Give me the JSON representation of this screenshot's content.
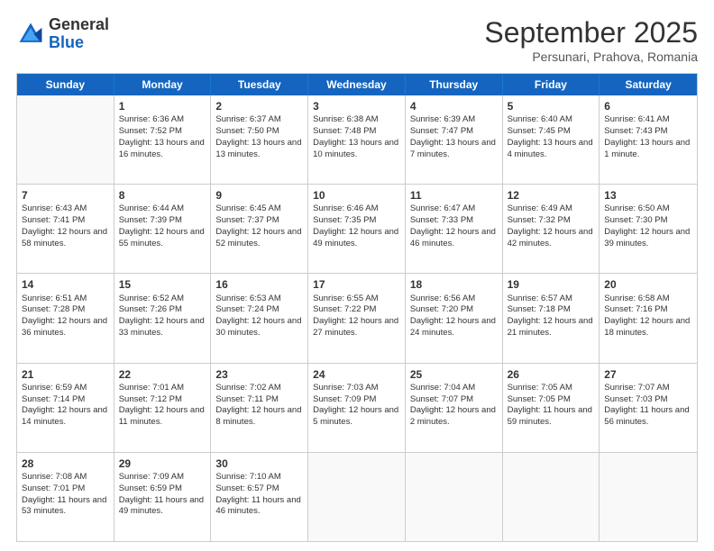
{
  "header": {
    "logo_general": "General",
    "logo_blue": "Blue",
    "month_title": "September 2025",
    "subtitle": "Persunari, Prahova, Romania"
  },
  "day_names": [
    "Sunday",
    "Monday",
    "Tuesday",
    "Wednesday",
    "Thursday",
    "Friday",
    "Saturday"
  ],
  "rows": [
    [
      {
        "num": "",
        "empty": true
      },
      {
        "num": "1",
        "sunrise": "Sunrise: 6:36 AM",
        "sunset": "Sunset: 7:52 PM",
        "daylight": "Daylight: 13 hours and 16 minutes."
      },
      {
        "num": "2",
        "sunrise": "Sunrise: 6:37 AM",
        "sunset": "Sunset: 7:50 PM",
        "daylight": "Daylight: 13 hours and 13 minutes."
      },
      {
        "num": "3",
        "sunrise": "Sunrise: 6:38 AM",
        "sunset": "Sunset: 7:48 PM",
        "daylight": "Daylight: 13 hours and 10 minutes."
      },
      {
        "num": "4",
        "sunrise": "Sunrise: 6:39 AM",
        "sunset": "Sunset: 7:47 PM",
        "daylight": "Daylight: 13 hours and 7 minutes."
      },
      {
        "num": "5",
        "sunrise": "Sunrise: 6:40 AM",
        "sunset": "Sunset: 7:45 PM",
        "daylight": "Daylight: 13 hours and 4 minutes."
      },
      {
        "num": "6",
        "sunrise": "Sunrise: 6:41 AM",
        "sunset": "Sunset: 7:43 PM",
        "daylight": "Daylight: 13 hours and 1 minute."
      }
    ],
    [
      {
        "num": "7",
        "sunrise": "Sunrise: 6:43 AM",
        "sunset": "Sunset: 7:41 PM",
        "daylight": "Daylight: 12 hours and 58 minutes."
      },
      {
        "num": "8",
        "sunrise": "Sunrise: 6:44 AM",
        "sunset": "Sunset: 7:39 PM",
        "daylight": "Daylight: 12 hours and 55 minutes."
      },
      {
        "num": "9",
        "sunrise": "Sunrise: 6:45 AM",
        "sunset": "Sunset: 7:37 PM",
        "daylight": "Daylight: 12 hours and 52 minutes."
      },
      {
        "num": "10",
        "sunrise": "Sunrise: 6:46 AM",
        "sunset": "Sunset: 7:35 PM",
        "daylight": "Daylight: 12 hours and 49 minutes."
      },
      {
        "num": "11",
        "sunrise": "Sunrise: 6:47 AM",
        "sunset": "Sunset: 7:33 PM",
        "daylight": "Daylight: 12 hours and 46 minutes."
      },
      {
        "num": "12",
        "sunrise": "Sunrise: 6:49 AM",
        "sunset": "Sunset: 7:32 PM",
        "daylight": "Daylight: 12 hours and 42 minutes."
      },
      {
        "num": "13",
        "sunrise": "Sunrise: 6:50 AM",
        "sunset": "Sunset: 7:30 PM",
        "daylight": "Daylight: 12 hours and 39 minutes."
      }
    ],
    [
      {
        "num": "14",
        "sunrise": "Sunrise: 6:51 AM",
        "sunset": "Sunset: 7:28 PM",
        "daylight": "Daylight: 12 hours and 36 minutes."
      },
      {
        "num": "15",
        "sunrise": "Sunrise: 6:52 AM",
        "sunset": "Sunset: 7:26 PM",
        "daylight": "Daylight: 12 hours and 33 minutes."
      },
      {
        "num": "16",
        "sunrise": "Sunrise: 6:53 AM",
        "sunset": "Sunset: 7:24 PM",
        "daylight": "Daylight: 12 hours and 30 minutes."
      },
      {
        "num": "17",
        "sunrise": "Sunrise: 6:55 AM",
        "sunset": "Sunset: 7:22 PM",
        "daylight": "Daylight: 12 hours and 27 minutes."
      },
      {
        "num": "18",
        "sunrise": "Sunrise: 6:56 AM",
        "sunset": "Sunset: 7:20 PM",
        "daylight": "Daylight: 12 hours and 24 minutes."
      },
      {
        "num": "19",
        "sunrise": "Sunrise: 6:57 AM",
        "sunset": "Sunset: 7:18 PM",
        "daylight": "Daylight: 12 hours and 21 minutes."
      },
      {
        "num": "20",
        "sunrise": "Sunrise: 6:58 AM",
        "sunset": "Sunset: 7:16 PM",
        "daylight": "Daylight: 12 hours and 18 minutes."
      }
    ],
    [
      {
        "num": "21",
        "sunrise": "Sunrise: 6:59 AM",
        "sunset": "Sunset: 7:14 PM",
        "daylight": "Daylight: 12 hours and 14 minutes."
      },
      {
        "num": "22",
        "sunrise": "Sunrise: 7:01 AM",
        "sunset": "Sunset: 7:12 PM",
        "daylight": "Daylight: 12 hours and 11 minutes."
      },
      {
        "num": "23",
        "sunrise": "Sunrise: 7:02 AM",
        "sunset": "Sunset: 7:11 PM",
        "daylight": "Daylight: 12 hours and 8 minutes."
      },
      {
        "num": "24",
        "sunrise": "Sunrise: 7:03 AM",
        "sunset": "Sunset: 7:09 PM",
        "daylight": "Daylight: 12 hours and 5 minutes."
      },
      {
        "num": "25",
        "sunrise": "Sunrise: 7:04 AM",
        "sunset": "Sunset: 7:07 PM",
        "daylight": "Daylight: 12 hours and 2 minutes."
      },
      {
        "num": "26",
        "sunrise": "Sunrise: 7:05 AM",
        "sunset": "Sunset: 7:05 PM",
        "daylight": "Daylight: 11 hours and 59 minutes."
      },
      {
        "num": "27",
        "sunrise": "Sunrise: 7:07 AM",
        "sunset": "Sunset: 7:03 PM",
        "daylight": "Daylight: 11 hours and 56 minutes."
      }
    ],
    [
      {
        "num": "28",
        "sunrise": "Sunrise: 7:08 AM",
        "sunset": "Sunset: 7:01 PM",
        "daylight": "Daylight: 11 hours and 53 minutes."
      },
      {
        "num": "29",
        "sunrise": "Sunrise: 7:09 AM",
        "sunset": "Sunset: 6:59 PM",
        "daylight": "Daylight: 11 hours and 49 minutes."
      },
      {
        "num": "30",
        "sunrise": "Sunrise: 7:10 AM",
        "sunset": "Sunset: 6:57 PM",
        "daylight": "Daylight: 11 hours and 46 minutes."
      },
      {
        "num": "",
        "empty": true
      },
      {
        "num": "",
        "empty": true
      },
      {
        "num": "",
        "empty": true
      },
      {
        "num": "",
        "empty": true
      }
    ]
  ]
}
